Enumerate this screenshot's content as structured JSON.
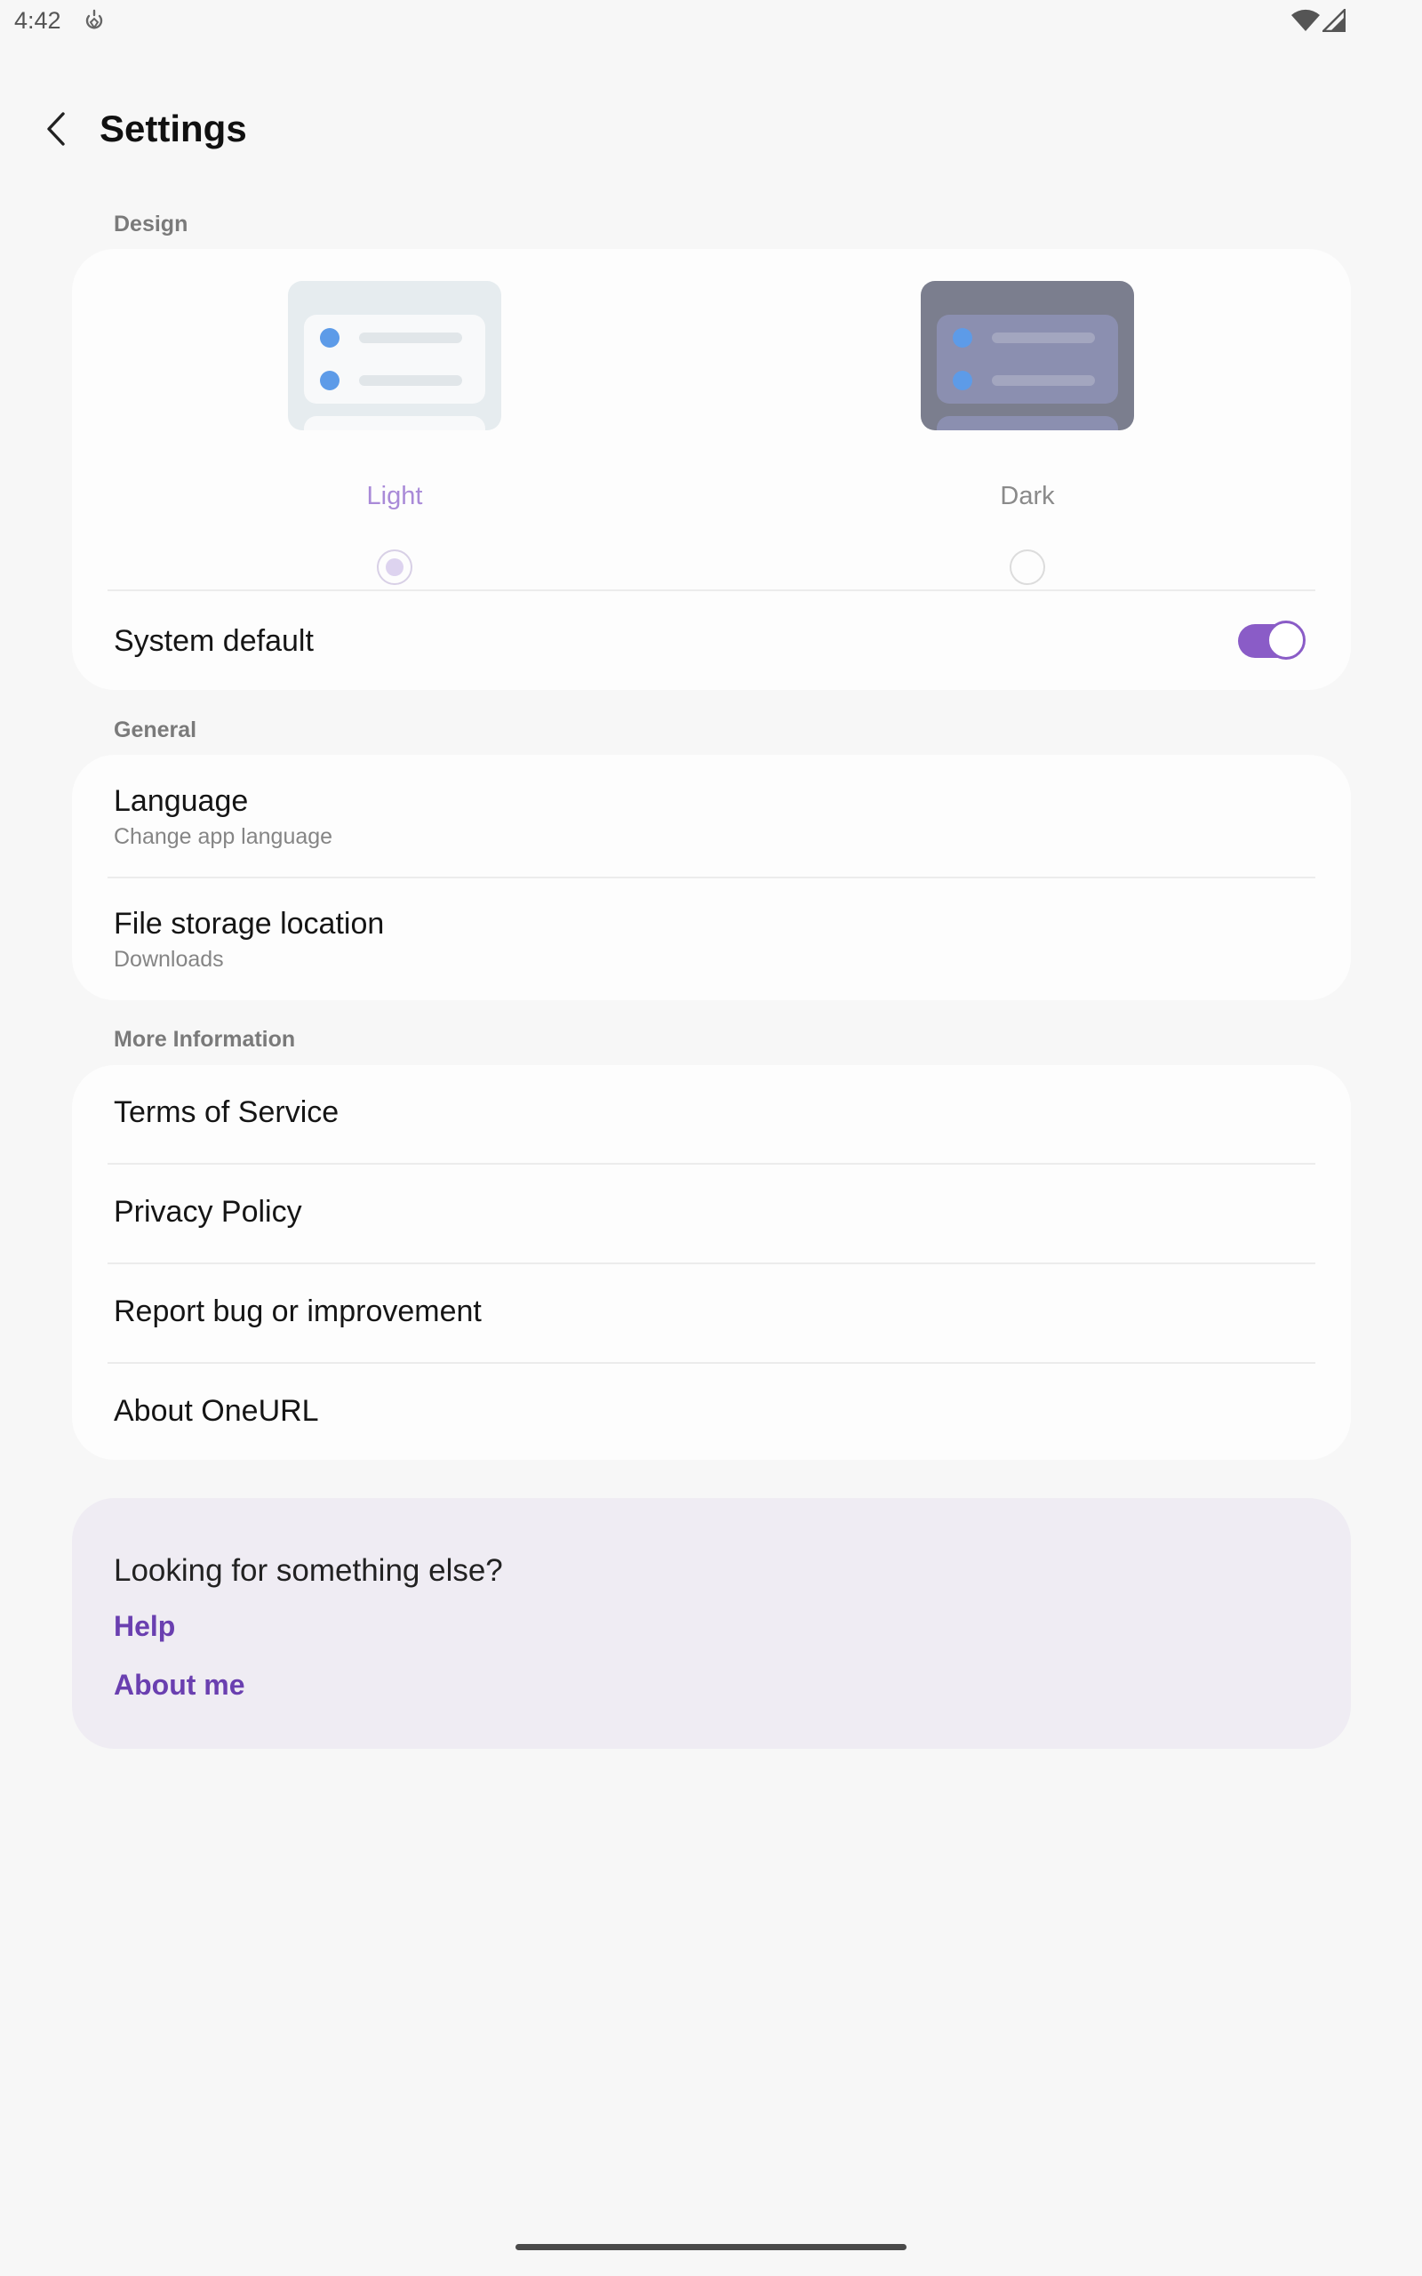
{
  "status_bar": {
    "time": "4:42",
    "icons": [
      "gauge-icon",
      "wifi-icon",
      "signal-icon"
    ]
  },
  "app_bar": {
    "back_icon": "chevron-left-icon",
    "title": "Settings"
  },
  "design": {
    "section_label": "Design",
    "themes": [
      {
        "label": "Light",
        "selected": true,
        "color": "#a98ad8"
      },
      {
        "label": "Dark",
        "selected": false,
        "color": "#8a8a8a"
      }
    ],
    "system_default": {
      "label": "System default",
      "enabled": true
    }
  },
  "general": {
    "section_label": "General",
    "items": [
      {
        "title": "Language",
        "subtitle": "Change app language"
      },
      {
        "title": "File storage location",
        "subtitle": "Downloads"
      }
    ]
  },
  "more_info": {
    "section_label": "More Information",
    "items": [
      {
        "title": "Terms of Service"
      },
      {
        "title": "Privacy Policy"
      },
      {
        "title": "Report bug or improvement"
      },
      {
        "title": "About OneURL"
      }
    ]
  },
  "help_card": {
    "title": "Looking for something else?",
    "links": [
      "Help",
      "About me"
    ]
  },
  "colors": {
    "accent": "#8a5cc7",
    "link": "#6a3fb0",
    "background": "#f7f7f7",
    "card": "#fdfdfd"
  }
}
